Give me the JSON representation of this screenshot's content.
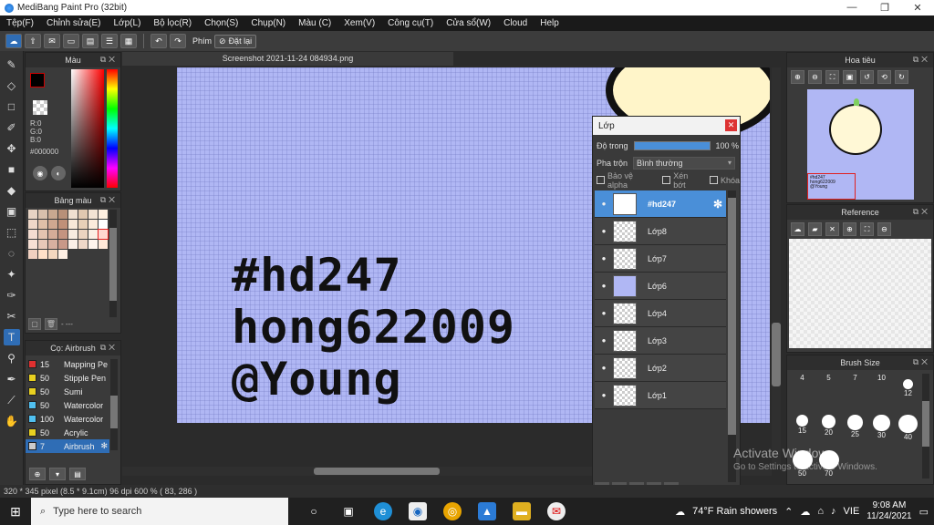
{
  "title_bar": {
    "title": "MediBang Paint Pro (32bit)",
    "minimize": "—",
    "restore": "❐",
    "close": "✕"
  },
  "menu": [
    "Tệp(F)",
    "Chỉnh sửa(E)",
    "Lớp(L)",
    "Bộ lọc(R)",
    "Chọn(S)",
    "Chụp(N)",
    "Màu (C)",
    "Xem(V)",
    "Công cụ(T)",
    "Cửa sổ(W)",
    "Cloud",
    "Help"
  ],
  "toolbar": {
    "key_label": "Phím",
    "reset_label": "Đặt lại"
  },
  "color_panel": {
    "title": "Màu",
    "r": "R:0",
    "g": "G:0",
    "b": "B:0",
    "hex": "#000000",
    "fg_color": "#000000",
    "bg_color": "#aaaaff"
  },
  "palette_panel": {
    "title": "Bảng màu",
    "footer_text": "- ---",
    "colors": [
      "#e8d4c4",
      "#d8c0ac",
      "#c8a890",
      "#b89078",
      "#f0e0d0",
      "#e0c8b0",
      "#f4e4d4",
      "#fff0e0",
      "#f0d8c8",
      "#e0c0a8",
      "#d0a890",
      "#c09078",
      "#f8e8d8",
      "#e8d0b8",
      "#fcecdc",
      "#ffffff",
      "#f4dcd0",
      "#e4c4b0",
      "#d4ac98",
      "#c49480",
      "#f8ece0",
      "#ecd4c0",
      "#fcf0e4",
      "#ffd8d0",
      "#f8e0d4",
      "#e8c8b8",
      "#d8b0a0",
      "#c89888",
      "#fcf0e8",
      "#f0d8c8",
      "#fff4ec",
      "#ffe8d8",
      "#f0d0c0",
      "#ffe0c8",
      "#f4d8c0",
      "#fff0e4"
    ]
  },
  "brush_panel": {
    "title": "Cọ: Airbrush",
    "items": [
      {
        "size": "15",
        "name": "Mapping Pe",
        "color": "#e03030"
      },
      {
        "size": "50",
        "name": "Stipple Pen",
        "color": "#e8d020"
      },
      {
        "size": "50",
        "name": "Sumi",
        "color": "#e8d020"
      },
      {
        "size": "50",
        "name": "Watercolor",
        "color": "#50c0f0"
      },
      {
        "size": "100",
        "name": "Watercolor",
        "color": "#50c0f0"
      },
      {
        "size": "50",
        "name": "Acrylic",
        "color": "#e8d020"
      },
      {
        "size": "7",
        "name": "Airbrush",
        "color": "#cccccc"
      }
    ]
  },
  "canvas": {
    "tab_title": "Screenshot 2021-11-24 084934.png",
    "lines": [
      "#hd247",
      "hong622009",
      "@Young"
    ]
  },
  "layer_panel": {
    "title": "Lớp",
    "opacity_label": "Độ trong",
    "opacity_value": "100 %",
    "blend_label": "Pha trộn",
    "blend_value": "Bình thường",
    "protect_alpha": "Bảo vệ alpha",
    "clipping": "Xén bớt",
    "lock": "Khóa",
    "layers": [
      "#hd247",
      "Lớp8",
      "Lớp7",
      "Lớp6",
      "Lớp4",
      "Lớp3",
      "Lớp2",
      "Lớp1"
    ]
  },
  "navigator": {
    "title": "Hoa tiêu"
  },
  "reference": {
    "title": "Reference"
  },
  "brush_size": {
    "title": "Brush Size",
    "sizes": [
      "4",
      "5",
      "7",
      "10",
      "12",
      "15",
      "20",
      "25",
      "30",
      "40",
      "50",
      "70"
    ]
  },
  "watermark": {
    "line1": "Activate Windows",
    "line2": "Go to Settings to activate Windows."
  },
  "status_bar": {
    "text": "320 * 345 pixel  (8.5 * 9.1cm)  96 dpi  600 %  ( 83, 286 )"
  },
  "taskbar": {
    "search_placeholder": "Type here to search",
    "weather": "74°F  Rain showers",
    "lang": "VIE",
    "time": "9:08 AM",
    "date": "11/24/2021"
  }
}
